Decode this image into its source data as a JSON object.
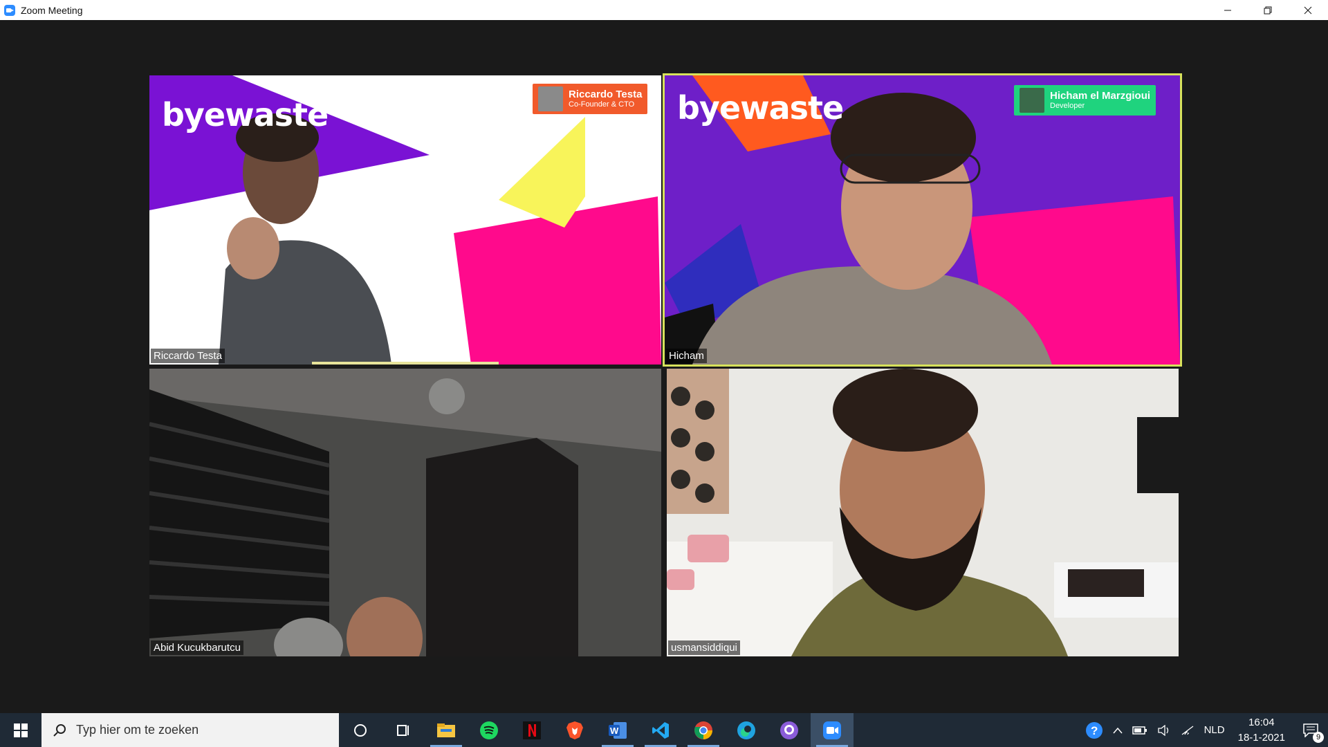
{
  "window": {
    "title": "Zoom Meeting"
  },
  "tiles": [
    {
      "participant": "Riccardo Testa",
      "brand": "byewaste",
      "card_name": "Riccardo Testa",
      "card_role": "Co-Founder & CTO",
      "card_color": "#f15a2b"
    },
    {
      "participant": "Hicham",
      "brand": "byewaste",
      "card_name": "Hicham el Marzgioui",
      "card_role": "Developer",
      "card_color": "#1fd37e",
      "active_speaker": true,
      "highlight_color": "#d7e25b"
    },
    {
      "participant": "Abid Kucukbarutcu"
    },
    {
      "participant": "usmansiddiqui"
    }
  ],
  "taskbar": {
    "search_placeholder": "Typ hier om te zoeken",
    "apps": [
      "cortana-icon",
      "task-view-icon",
      "file-explorer-icon",
      "spotify-icon",
      "netflix-icon",
      "brave-icon",
      "word-icon",
      "vscode-icon",
      "chrome-icon",
      "edge-icon",
      "github-desktop-icon",
      "zoom-icon"
    ],
    "language": "NLD",
    "time": "16:04",
    "date": "18-1-2021",
    "notification_count": "9"
  },
  "colors": {
    "brand_purple": "#6e1fc8",
    "brand_pink": "#ff0a8c",
    "brand_yellow": "#f8f45a",
    "brand_orange": "#ff5a1f"
  }
}
